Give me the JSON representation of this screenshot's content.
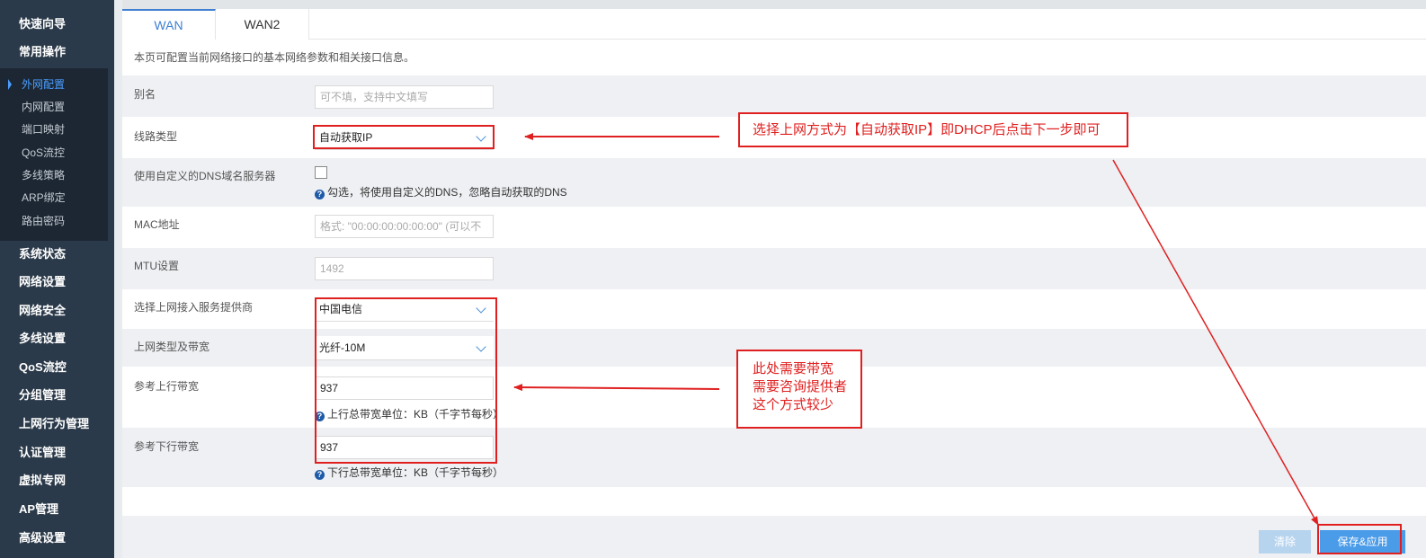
{
  "sidebar": {
    "top_items": [
      "快速向导",
      "常用操作"
    ],
    "sub_items": [
      "外网配置",
      "内网配置",
      "端口映射",
      "QoS流控",
      "多线策略",
      "ARP绑定",
      "路由密码"
    ],
    "bottom_items": [
      "系统状态",
      "网络设置",
      "网络安全",
      "多线设置",
      "QoS流控",
      "分组管理",
      "上网行为管理",
      "认证管理",
      "虚拟专网",
      "AP管理",
      "高级设置"
    ]
  },
  "tabs": [
    "WAN",
    "WAN2"
  ],
  "description": "本页可配置当前网络接口的基本网络参数和相关接口信息。",
  "form": {
    "alias_label": "别名",
    "alias_placeholder": "可不填，支持中文填写",
    "line_type_label": "线路类型",
    "line_type_value": "自动获取IP",
    "custom_dns_label": "使用自定义的DNS域名服务器",
    "custom_dns_help": "勾选，将使用自定义的DNS，忽略自动获取的DNS",
    "mac_label": "MAC地址",
    "mac_placeholder": "格式: \"00:00:00:00:00:00\" (可以不",
    "mtu_label": "MTU设置",
    "mtu_placeholder": "1492",
    "isp_label": "选择上网接入服务提供商",
    "isp_value": "中国电信",
    "bandwidth_type_label": "上网类型及带宽",
    "bandwidth_type_value": "光纤-10M",
    "upload_label": "参考上行带宽",
    "upload_value": "937",
    "upload_help": "上行总带宽单位：KB（千字节每秒）",
    "download_label": "参考下行带宽",
    "download_value": "937",
    "download_help": "下行总带宽单位：KB（千字节每秒）"
  },
  "footer": {
    "clear_label": "清除",
    "save_label": "保存&应用"
  },
  "annotations": {
    "note1": "选择上网方式为【自动获取IP】即DHCP后点击下一步即可",
    "note2_lines": [
      "此处需要带宽",
      "需要咨询提供者",
      "这个方式较少"
    ]
  },
  "colors": {
    "sidebar_bg": "#2b3a4a",
    "accent": "#3e7fd1",
    "annotation": "#e02020"
  }
}
